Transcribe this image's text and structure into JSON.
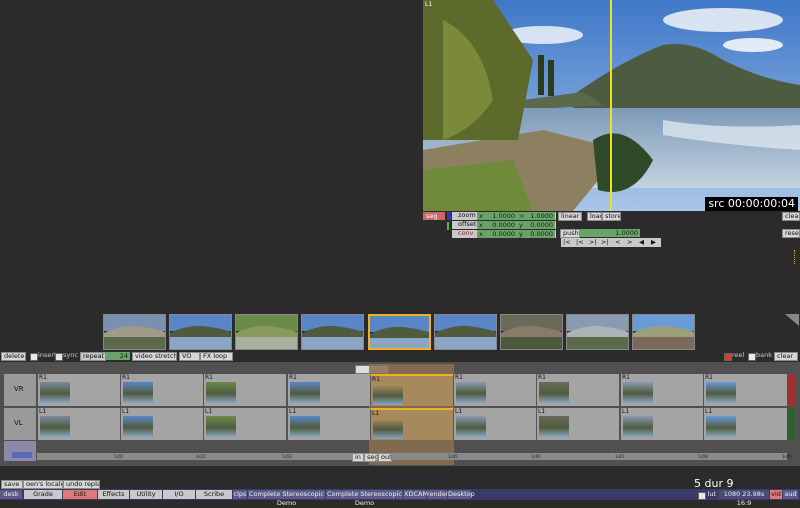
{
  "viewer": {
    "corner_label": "L1",
    "timecode": "src 00:00:00:04"
  },
  "controls": {
    "seg_label": "seg",
    "zoom_label": "zoom",
    "offset_label": "offset",
    "conv_label": "conv",
    "x_label": "x",
    "y_label": "y",
    "gt_label": ">",
    "zoom_x": "1.0000",
    "zoom_y": "1.0000",
    "offset_x": "0.0000",
    "offset_y": "0.0000",
    "conv_x": "0.0000",
    "conv_y": "0.0000",
    "linear_label": "linear",
    "load_label": "load",
    "store_label": "store",
    "push_label": "push",
    "push_value": "1.0000",
    "clear_label": "clear",
    "reset_label": "reset",
    "transport": [
      "|<",
      "|<",
      ">|",
      ">|",
      "<",
      ">",
      "◀",
      "▶"
    ]
  },
  "bin_bar": {
    "delete_label": "delete",
    "insert_label": "insert",
    "sync_label": "sync",
    "repeat_label": "repeat",
    "repeat_value": "24",
    "video_stretch_label": "video stretch",
    "vo_label": "VO",
    "fx_loop_label": "FX loop",
    "reel_label": "reel",
    "bank_label": "bank",
    "clear_label": "clear"
  },
  "thumbnails": [
    {
      "name": "thumb-1",
      "scene": "building"
    },
    {
      "name": "thumb-2",
      "scene": "lake"
    },
    {
      "name": "thumb-3",
      "scene": "trees"
    },
    {
      "name": "thumb-4",
      "scene": "lake"
    },
    {
      "name": "thumb-5",
      "scene": "lake-selected"
    },
    {
      "name": "thumb-6",
      "scene": "lake"
    },
    {
      "name": "thumb-7",
      "scene": "rocks"
    },
    {
      "name": "thumb-8",
      "scene": "bridge"
    },
    {
      "name": "thumb-9",
      "scene": "tower"
    }
  ],
  "timeline": {
    "track_vr": "VR",
    "track_vl": "VL",
    "clip_label_top": "R1",
    "clip_label_bottom": "L1",
    "in_label": "in",
    "seg_label": "seg",
    "out_label": "out",
    "ruler_ticks": [
      "1s01",
      "1s02",
      "1s03",
      "1s04",
      "1s05",
      "1s06",
      "1s07",
      "1s08",
      "1s09"
    ]
  },
  "status": {
    "dur": "5 dur 9",
    "save_label": "save",
    "locale_label": "oen's locale",
    "undo_label": "undo replace"
  },
  "tabs": {
    "desk": "desk",
    "grade": "Grade",
    "edit": "Edit",
    "effects": "Effects",
    "utility": "Utility",
    "io": "I/O",
    "scribe": "Scribe",
    "clps": "clps",
    "demo1": "Complete Stereoscopic Demo",
    "demo2": "Complete Stereoscopic Demo",
    "xdcam": "XDCAM",
    "render": "render",
    "desktop": "Desktop",
    "lut": "lut",
    "format": "1080 23.98s 16:9",
    "vid": "vid",
    "aud": "aud"
  },
  "colors": {
    "accent_green": "#6aa36a",
    "accent_red": "#c86a6a",
    "selection_tan": "#8a7050",
    "playhead_yellow": "#f0e020"
  }
}
